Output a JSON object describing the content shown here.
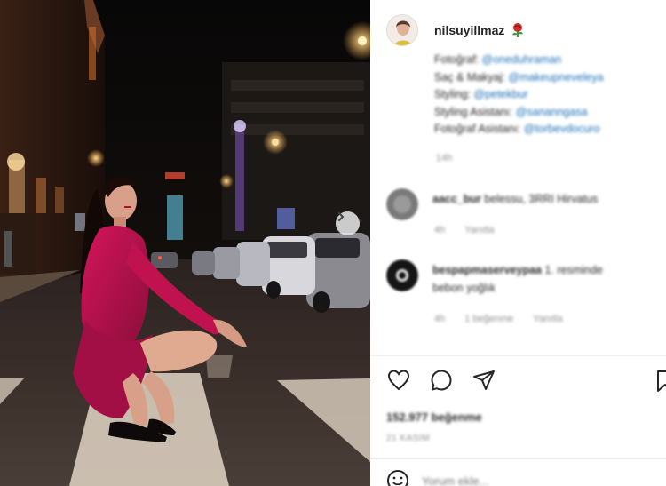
{
  "post": {
    "username": "nilsuyillmaz",
    "badge_icon": "rose-icon",
    "next_icon": "chevron-right-icon"
  },
  "caption": {
    "lines": [
      {
        "label": "Fotoğraf:",
        "tag": "@oneduhraman"
      },
      {
        "label": "Saç & Makyaj:",
        "tag": "@makeupneveleya"
      },
      {
        "label": "Styling:",
        "tag": "@petekbur"
      },
      {
        "label": "Styling Asistanı:",
        "tag": "@sananngasa"
      },
      {
        "label": "Fotoğraf Asistanı:",
        "tag": "@torbevdocuro"
      }
    ],
    "time": "14h"
  },
  "comments": [
    {
      "user": "aacc_bur",
      "text": "belessu, 3RRI Hirvatus",
      "meta": [
        "4h",
        "Yanıtla"
      ]
    },
    {
      "user": "bespapmaserveypaa",
      "text": "1. resminde bebon yoğlık",
      "meta": [
        "4h",
        "1 beğenme",
        "Yanıtla"
      ]
    }
  ],
  "footer": {
    "likes": "152.977 beğenme",
    "date": "21 KASIM",
    "comment_placeholder": "Yorum ekle..."
  },
  "icons": {
    "like": "heart-icon",
    "comment": "comment-icon",
    "share": "send-icon",
    "save": "bookmark-icon",
    "emoji": "smiley-icon"
  },
  "colors": {
    "link": "#1d6fb8",
    "text": "#262626",
    "muted": "#8e8e8e",
    "dress": "#b0124a"
  }
}
